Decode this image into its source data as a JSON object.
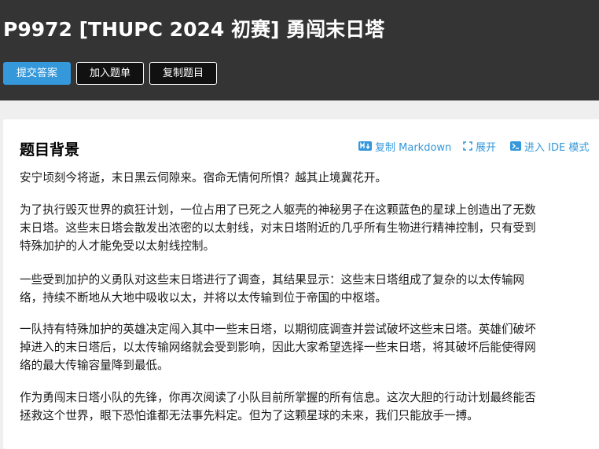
{
  "header": {
    "title": "P9972 [THUPC 2024 初赛] 勇闯末日塔",
    "buttons": {
      "submit": "提交答案",
      "add_to_list": "加入题单",
      "copy_problem": "复制题目"
    }
  },
  "section": {
    "title": "题目背景",
    "actions": {
      "copy_markdown": "复制 Markdown",
      "expand": "展开",
      "ide_mode": "进入 IDE 模式"
    }
  },
  "paragraphs": [
    [
      "安宁顷刻今将逝，末日黑云伺隙来。宿命无情何所惧？越其止境冀花开。"
    ],
    [
      "为了执行毁灭世界的疯狂计划，一位占用了已死之人躯壳的神秘男子在这颗蓝色的星球上创造出了无数",
      "末日塔。这些末日塔会散发出浓密的以太射线，对末日塔附近的几乎所有生物进行精神控制，只有受到",
      "特殊加护的人才能免受以太射线控制。"
    ],
    [
      "一些受到加护的义勇队对这些末日塔进行了调查，其结果显示：这些末日塔组成了复杂的以太传输网",
      "络，持续不断地从大地中吸收以太，并将以太传输到位于帝国的中枢塔。"
    ],
    [
      "一队持有特殊加护的英雄决定闯入其中一些末日塔，以期彻底调查并尝试破坏这些末日塔。英雄们破坏",
      "掉进入的末日塔后，以太传输网络就会受到影响，因此大家希望选择一些末日塔，将其破坏后能使得网",
      "络的最大传输容量降到最低。"
    ],
    [
      "作为勇闯末日塔小队的先锋，你再次阅读了小队目前所掌握的所有信息。这次大胆的行动计划最终能否",
      "拯救这个世界，眼下恐怕谁都无法事先料定。但为了这颗星球的未来，我们只能放手一搏。"
    ]
  ]
}
